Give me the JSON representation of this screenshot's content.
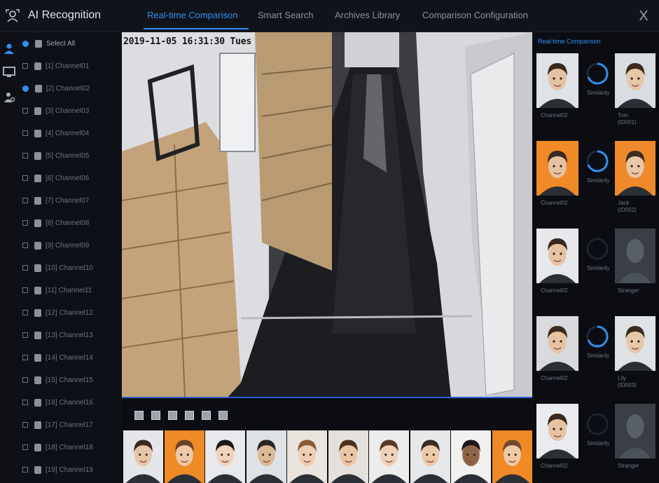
{
  "app": {
    "title": "AI Recognition",
    "icon": "face-scan-icon"
  },
  "tabs": [
    {
      "label": "Real-time Comparison",
      "active": true
    },
    {
      "label": "Smart Search",
      "active": false
    },
    {
      "label": "Archives Library",
      "active": false
    },
    {
      "label": "Comparison Configuration",
      "active": false
    }
  ],
  "close_label": "X",
  "rail_icons": [
    "user-icon",
    "monitor-icon",
    "person-settings-icon"
  ],
  "channels": [
    {
      "label": "Select All",
      "checked": true
    },
    {
      "label": "[1] Channel01",
      "checked": false
    },
    {
      "label": "[2] Channel02",
      "checked": true
    },
    {
      "label": "[3] Channel03",
      "checked": false
    },
    {
      "label": "[4] Channel04",
      "checked": false
    },
    {
      "label": "[5] Channel05",
      "checked": false
    },
    {
      "label": "[6] Channel06",
      "checked": false
    },
    {
      "label": "[7] Channel07",
      "checked": false
    },
    {
      "label": "[8] Channel08",
      "checked": false
    },
    {
      "label": "[9] Channel09",
      "checked": false
    },
    {
      "label": "[10] Channel10",
      "checked": false
    },
    {
      "label": "[11] Channel11",
      "checked": false
    },
    {
      "label": "[12] Channel12",
      "checked": false
    },
    {
      "label": "[13] Channel13",
      "checked": false
    },
    {
      "label": "[14] Channel14",
      "checked": false
    },
    {
      "label": "[15] Channel15",
      "checked": false
    },
    {
      "label": "[16] Channel16",
      "checked": false
    },
    {
      "label": "[17] Channel17",
      "checked": false
    },
    {
      "label": "[18] Channel18",
      "checked": false
    },
    {
      "label": "[19] Channel19",
      "checked": false
    }
  ],
  "video": {
    "osd": "2019-11-05 16:31:30 Tues"
  },
  "toolbar_icons": [
    "layout-1-icon",
    "layout-4-icon",
    "layout-9-icon",
    "layout-16-icon",
    "snapshot-icon",
    "record-icon"
  ],
  "right_panel": {
    "title": "Real-time Comparison",
    "matches": [
      {
        "channel": "Channel02",
        "similarity": "Similarity",
        "library_name": "Tom",
        "library_note": "(ID001)",
        "cap_bg": "#dfe3e8",
        "lib_bg": "#d9dde2",
        "ring": "#2f8ff0",
        "unknown": false
      },
      {
        "channel": "Channel02",
        "similarity": "Similarity",
        "library_name": "Jack",
        "library_note": "(ID002)",
        "cap_bg": "#f08a26",
        "lib_bg": "#ee8a2c",
        "ring": "#2f8ff0",
        "unknown": false
      },
      {
        "channel": "Channel02",
        "similarity": "Similarity",
        "library_name": "Stranger",
        "library_note": "",
        "cap_bg": "#e6e8eb",
        "lib_bg": "#3a3f45",
        "ring": "",
        "unknown": true
      },
      {
        "channel": "Channel02",
        "similarity": "Similarity",
        "library_name": "Lily",
        "library_note": "(ID003)",
        "cap_bg": "#d8dadd",
        "lib_bg": "#dfe2e5",
        "ring": "#2f8ff0",
        "unknown": false
      },
      {
        "channel": "Channel02",
        "similarity": "Similarity",
        "library_name": "Stranger",
        "library_note": "",
        "cap_bg": "#e9ebee",
        "lib_bg": "#3a3f45",
        "ring": "",
        "unknown": true
      }
    ]
  },
  "snapshots": [
    {
      "bg": "#e4e6e9",
      "hair": "#3a2a1e",
      "skin": "#e8c4a8"
    },
    {
      "bg": "#f08a26",
      "hair": "#6b4427",
      "skin": "#eec8a6"
    },
    {
      "bg": "#e7e9ec",
      "hair": "#1c1a19",
      "skin": "#efd2b8"
    },
    {
      "bg": "#dfe2e5",
      "hair": "#2a2320",
      "skin": "#dcb896"
    },
    {
      "bg": "#e9e4de",
      "hair": "#8a5a35",
      "skin": "#efcdb2"
    },
    {
      "bg": "#e4e1dd",
      "hair": "#4a3020",
      "skin": "#eac5a4"
    },
    {
      "bg": "#ececea",
      "hair": "#5a3a25",
      "skin": "#f0cfb4"
    },
    {
      "bg": "#e6e8ea",
      "hair": "#3b2c22",
      "skin": "#ecc8a9"
    },
    {
      "bg": "#f1f1ef",
      "hair": "#1d1917",
      "skin": "#8f6548"
    },
    {
      "bg": "#f08a26",
      "hair": "#6e4a2c",
      "skin": "#efc8a6"
    }
  ]
}
